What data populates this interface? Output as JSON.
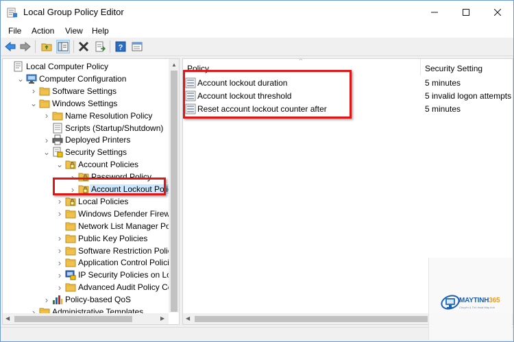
{
  "window": {
    "title": "Local Group Policy Editor"
  },
  "menu": {
    "items": [
      "File",
      "Action",
      "View",
      "Help"
    ]
  },
  "toolbar": {
    "buttons": [
      "back-icon",
      "forward-icon",
      "up-folder-icon",
      "show-hide-tree-icon",
      "delete-icon",
      "export-list-icon",
      "help-icon",
      "properties-icon"
    ]
  },
  "tree": {
    "items": [
      {
        "label": "Local Computer Policy",
        "icon": "policy-root-icon"
      },
      {
        "label": "Computer Configuration",
        "icon": "computer-icon",
        "expanded": true
      },
      {
        "label": "Software Settings",
        "icon": "folder-icon"
      },
      {
        "label": "Windows Settings",
        "icon": "folder-icon",
        "expanded": true
      },
      {
        "label": "Name Resolution Policy",
        "icon": "folder-icon"
      },
      {
        "label": "Scripts (Startup/Shutdown)",
        "icon": "scripts-icon"
      },
      {
        "label": "Deployed Printers",
        "icon": "printer-icon"
      },
      {
        "label": "Security Settings",
        "icon": "security-icon",
        "expanded": true
      },
      {
        "label": "Account Policies",
        "icon": "security-folder-icon",
        "expanded": true
      },
      {
        "label": "Password Policy",
        "icon": "security-folder-icon"
      },
      {
        "label": "Account Lockout Policy",
        "icon": "security-folder-icon",
        "selected": true
      },
      {
        "label": "Local Policies",
        "icon": "security-folder-icon"
      },
      {
        "label": "Windows Defender Firewall",
        "icon": "folder-icon"
      },
      {
        "label": "Network List Manager Polici",
        "icon": "folder-icon"
      },
      {
        "label": "Public Key Policies",
        "icon": "folder-icon"
      },
      {
        "label": "Software Restriction Policies",
        "icon": "folder-icon"
      },
      {
        "label": "Application Control Policies",
        "icon": "folder-icon"
      },
      {
        "label": "IP Security Policies on Local",
        "icon": "ip-security-icon"
      },
      {
        "label": "Advanced Audit Policy Conf",
        "icon": "folder-icon"
      },
      {
        "label": "Policy-based QoS",
        "icon": "qos-chart-icon"
      },
      {
        "label": "Administrative Templates",
        "icon": "folder-icon"
      }
    ]
  },
  "list": {
    "columns": {
      "policy": "Policy",
      "setting": "Security Setting"
    },
    "rows": [
      {
        "policy": "Account lockout duration",
        "setting": "5 minutes"
      },
      {
        "policy": "Account lockout threshold",
        "setting": "5 invalid logon attempts"
      },
      {
        "policy": "Reset account lockout counter after",
        "setting": "5 minutes"
      }
    ]
  },
  "watermark": {
    "brand_text": "MAYTINH",
    "brand_number": "365",
    "tagline": "Chuyên & Thủ thuật Máy tính"
  },
  "colors": {
    "highlight": "#e01515",
    "selection": "#cce8ff",
    "folder": "#f0c24d"
  }
}
